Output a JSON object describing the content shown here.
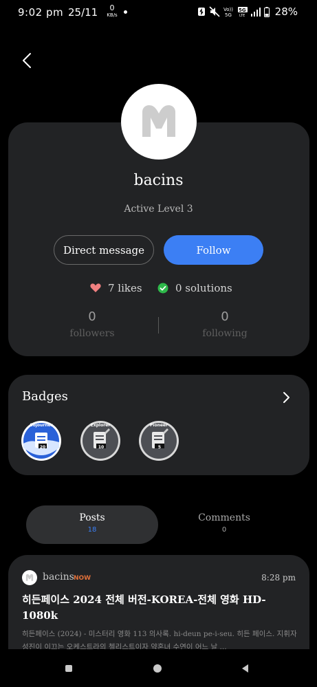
{
  "status_bar": {
    "time": "9:02 pm",
    "date": "25/11",
    "net_speed": "0",
    "net_unit": "KB/s",
    "battery": "28%",
    "icons": [
      "notification-icon",
      "mute-icon",
      "volte-icon",
      "5g-icon",
      "signal-icon",
      "battery-icon"
    ]
  },
  "header": {
    "back_icon": "chevron-left-icon"
  },
  "profile": {
    "avatar_letter": "M",
    "username": "bacins",
    "level": "Active Level 3",
    "dm_label": "Direct message",
    "follow_label": "Follow",
    "likes": "7 likes",
    "solutions": "0 solutions",
    "followers_count": "0",
    "followers_label": "followers",
    "following_count": "0",
    "following_label": "following"
  },
  "badges": {
    "title": "Badges",
    "items": [
      {
        "name": "Sojourner",
        "count": "20",
        "color": "#2a61d8"
      },
      {
        "name": "Explorer",
        "count": "10",
        "color": "#4d4f54"
      },
      {
        "name": "Pioneer",
        "count": "5",
        "color": "#4d4f54"
      }
    ]
  },
  "tabs": {
    "posts_label": "Posts",
    "posts_count": "18",
    "comments_label": "Comments",
    "comments_count": "0"
  },
  "post": {
    "author": "bacins",
    "badge": "NOW",
    "time": "8:28 pm",
    "title": "히든페이스 2024 전체 버전-KOREA-전체 영화 HD-1080k",
    "body": "히든페이스 (2024) - 미스터리 영화 113 의사록. hi-deun pe-i-seu. 히든 페이스. 지휘자 성진이 이끄는 오케스트라의 첼리스트이자 약혼녀 수연이 어느 날 ..."
  },
  "colors": {
    "background": "#000000",
    "card": "#222325",
    "accent": "#3c7ff4",
    "like": "#f08080",
    "solution": "#2eb84a",
    "now": "#e0703a"
  }
}
